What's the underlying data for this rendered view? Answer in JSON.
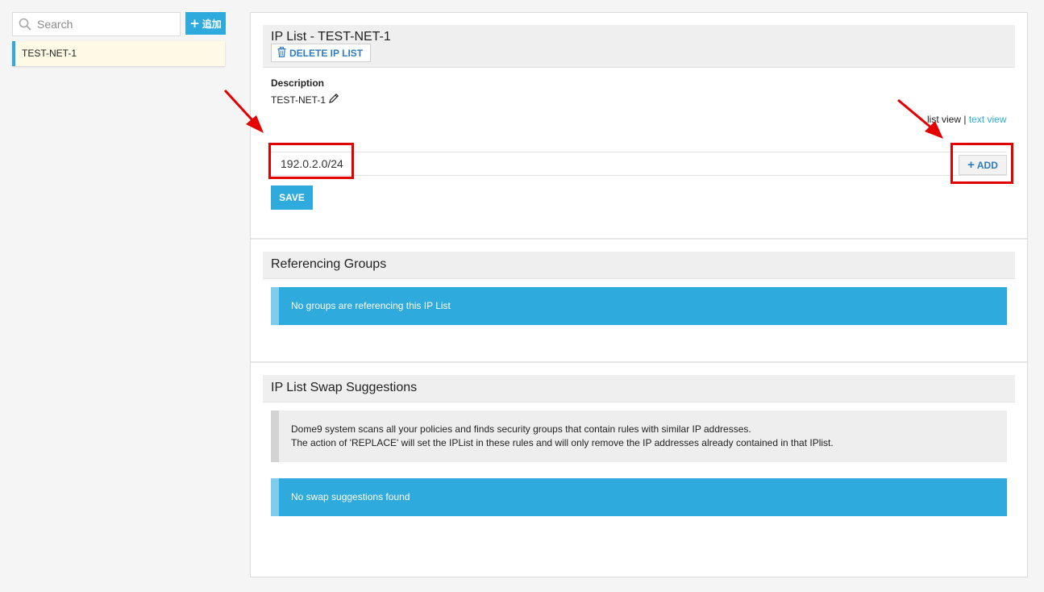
{
  "sidebar": {
    "search": {
      "placeholder": "Search",
      "value": ""
    },
    "add_button_label": "追加",
    "items": [
      {
        "label": "TEST-NET-1",
        "selected": true
      }
    ]
  },
  "ip_list": {
    "title": "IP List - TEST-NET-1",
    "delete_label": "DELETE IP LIST",
    "description_label": "Description",
    "description_value": "TEST-NET-1",
    "view_toggle": {
      "list_view": "list view",
      "separator": "|",
      "text_view": "text view"
    },
    "entry_value": "192.0.2.0/24",
    "add_label": "ADD",
    "save_label": "SAVE"
  },
  "referencing_groups": {
    "title": "Referencing Groups",
    "message": "No groups are referencing this IP List"
  },
  "swap_suggestions": {
    "title": "IP List Swap Suggestions",
    "info_line1": "Dome9 system scans all your policies and finds security groups that contain rules with similar IP addresses.",
    "info_line2": "The action of 'REPLACE' will set the IPList in these rules and will only remove the IP addresses already contained in that IPlist.",
    "message": "No swap suggestions found"
  },
  "colors": {
    "accent": "#2eaadc",
    "link": "#2f7cbf",
    "annotation": "#e30000",
    "selected_item_bg": "#fefae6"
  }
}
